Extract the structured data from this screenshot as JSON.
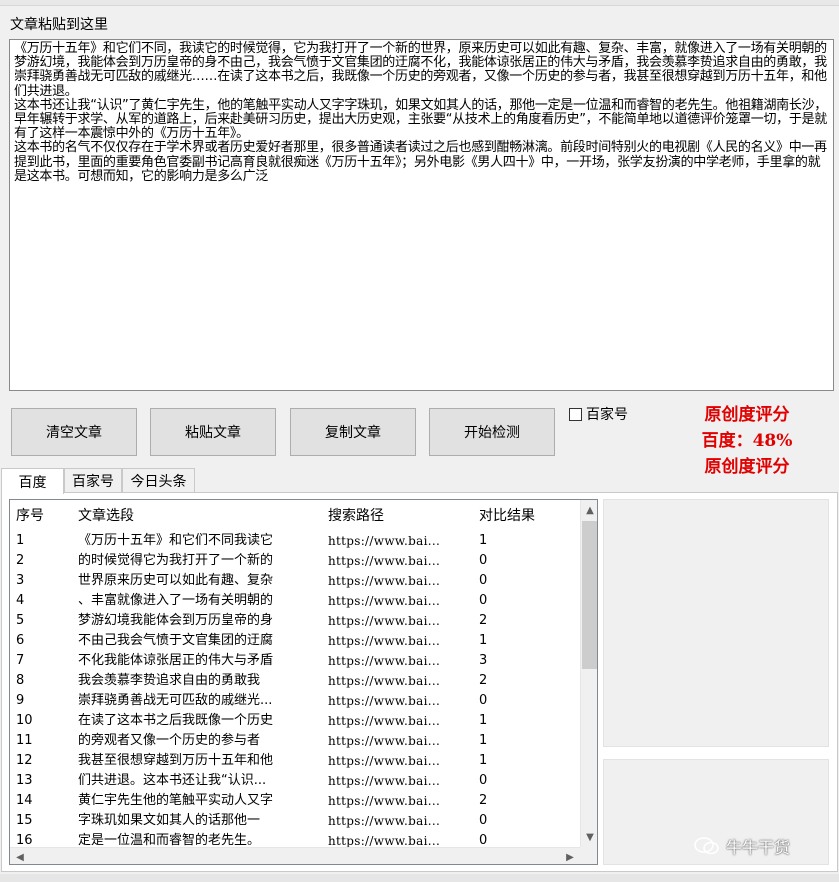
{
  "paste_label": "文章粘贴到这里",
  "article_text": "《万历十五年》和它们不同，我读它的时候觉得，它为我打开了一个新的世界，原来历史可以如此有趣、复杂、丰富，就像进入了一场有关明朝的梦游幻境，我能体会到万历皇帝的身不由己，我会气愤于文官集团的迂腐不化，我能体谅张居正的伟大与矛盾，我会羡慕李贽追求自由的勇敢，我崇拜骁勇善战无可匹敌的戚继光……在读了这本书之后，我既像一个历史的旁观者，又像一个历史的参与者，我甚至很想穿越到万历十五年，和他们共进退。\n这本书还让我“认识”了黄仁宇先生，他的笔触平实动人又字字珠玑，如果文如其人的话，那他一定是一位温和而睿智的老先生。他祖籍湖南长沙，早年辗转于求学、从军的道路上，后来赴美研习历史，提出大历史观，主张要“从技术上的角度看历史”，不能简单地以道德评价笼罩一切，于是就有了这样一本震惊中外的《万历十五年》。\n这本书的名气不仅仅存在于学术界或者历史爱好者那里，很多普通读者读过之后也感到酣畅淋漓。前段时间特别火的电视剧《人民的名义》中一再提到此书，里面的重要角色官委副书记高育良就很痴迷《万历十五年》；另外电影《男人四十》中，一开场，张学友扮演的中学老师，手里拿的就是这本书。可想而知，它的影响力是多么广泛",
  "buttons": {
    "clear": "清空文章",
    "paste": "粘贴文章",
    "copy": "复制文章",
    "start": "开始检测"
  },
  "checkbox_label": "百家号",
  "score": {
    "line1": "原创度评分",
    "line2": "百度：48%",
    "line3": "原创度评分"
  },
  "tabs": [
    "百度",
    "百家号",
    "今日头条"
  ],
  "table": {
    "headers": [
      "序号",
      "文章选段",
      "搜索路径",
      "对比结果"
    ],
    "rows": [
      [
        "1",
        "《万历十五年》和它们不同我读它",
        "https://www.bai...",
        "1"
      ],
      [
        "2",
        "的时候觉得它为我打开了一个新的",
        "https://www.bai...",
        "0"
      ],
      [
        "3",
        "世界原来历史可以如此有趣、复杂",
        "https://www.bai...",
        "0"
      ],
      [
        "4",
        "、丰富就像进入了一场有关明朝的",
        "https://www.bai...",
        "0"
      ],
      [
        "5",
        "梦游幻境我能体会到万历皇帝的身",
        "https://www.bai...",
        "2"
      ],
      [
        "6",
        "不由己我会气愤于文官集团的迂腐",
        "https://www.bai...",
        "1"
      ],
      [
        "7",
        "不化我能体谅张居正的伟大与矛盾",
        "https://www.bai...",
        "3"
      ],
      [
        "8",
        "我会羡慕李贽追求自由的勇敢我",
        "https://www.bai...",
        "2"
      ],
      [
        "9",
        "崇拜骁勇善战无可匹敌的戚继光...",
        "https://www.bai...",
        "0"
      ],
      [
        "10",
        "在读了这本书之后我既像一个历史",
        "https://www.bai...",
        "1"
      ],
      [
        "11",
        "的旁观者又像一个历史的参与者",
        "https://www.bai...",
        "1"
      ],
      [
        "12",
        "我甚至很想穿越到万历十五年和他",
        "https://www.bai...",
        "1"
      ],
      [
        "13",
        "们共进退。这本书还让我“认识...",
        "https://www.bai...",
        "0"
      ],
      [
        "14",
        "黄仁宇先生他的笔触平实动人又字",
        "https://www.bai...",
        "2"
      ],
      [
        "15",
        "字珠玑如果文如其人的话那他一",
        "https://www.bai...",
        "0"
      ],
      [
        "16",
        "定是一位温和而睿智的老先生。",
        "https://www.bai...",
        "0"
      ]
    ]
  },
  "watermark": "牛牛干货",
  "colors": {
    "score": "#e00000"
  }
}
